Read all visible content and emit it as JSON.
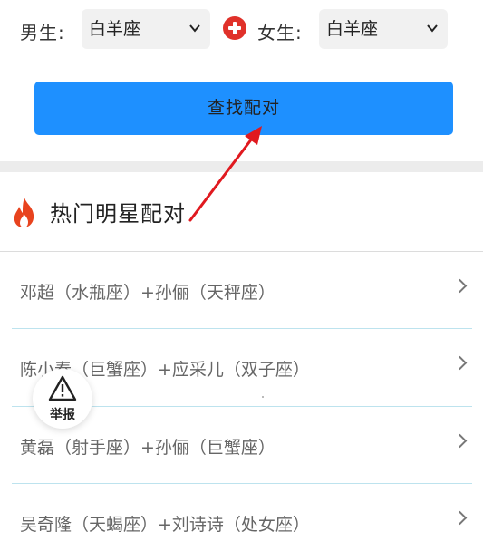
{
  "selector": {
    "male_label": "男生:",
    "male_value": "白羊座",
    "female_label": "女生:",
    "female_value": "白羊座"
  },
  "search_button": "查找配对",
  "section": {
    "title": "热门明星配对"
  },
  "pairs": [
    {
      "label": "邓超（水瓶座）+孙俪（天秤座）"
    },
    {
      "label": "陈小春（巨蟹座）+应采儿（双子座）"
    },
    {
      "label": "黄磊（射手座）+孙俪（巨蟹座）"
    },
    {
      "label": "吴奇隆（天蝎座）+刘诗诗（处女座）"
    }
  ],
  "report": {
    "label": "举报"
  },
  "colors": {
    "accent": "#1e90ff",
    "plus": "#e0312a",
    "arrow": "#e0191f",
    "fire": "#e8431e"
  }
}
